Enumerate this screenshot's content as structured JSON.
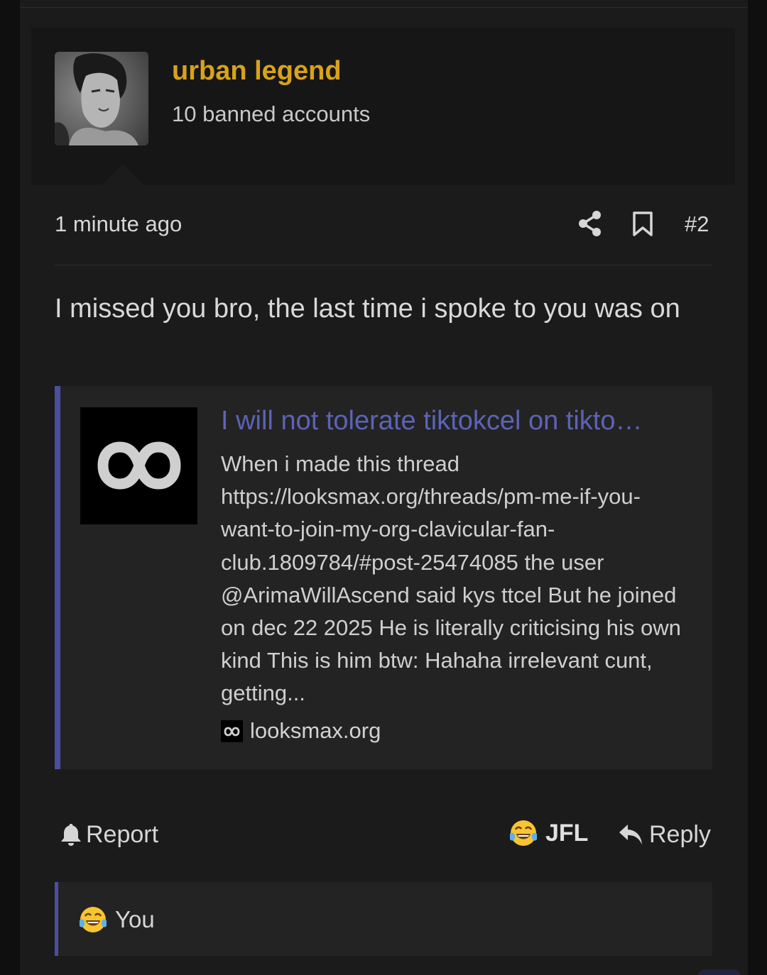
{
  "user": {
    "name": "urban legend",
    "title": "10 banned accounts",
    "avatar": "avatar-photo"
  },
  "post": {
    "time": "1 minute ago",
    "number": "#2",
    "body": "I missed you bro, the last time i spoke to you was on"
  },
  "embed": {
    "title": "I will not tolerate tiktokcel on tikto…",
    "snippet": "When i made this thread https://looksmax.org/threads/pm-me-if-you-want-to-join-my-org-clavicular-fan-club.1809784/#post-25474085 the user @ArimaWillAscend said kys ttcel But he joined on dec 22 2025 He is literally criticising his own kind This is him btw: Hahaha irrelevant cunt, getting...",
    "source": "looksmax.org",
    "thumbnail_icon": "infinity-logo",
    "accent_color": "#4a4fa0",
    "title_color": "#5c63b4"
  },
  "actions": {
    "report_label": "Report",
    "reaction_label": "JFL",
    "reply_label": "Reply",
    "reaction_icon": "crying-laughing-emoji"
  },
  "reactions": {
    "summary": "You",
    "icon": "crying-laughing-emoji"
  },
  "colors": {
    "username": "#d8a21a",
    "background": "#1b1b1c"
  }
}
